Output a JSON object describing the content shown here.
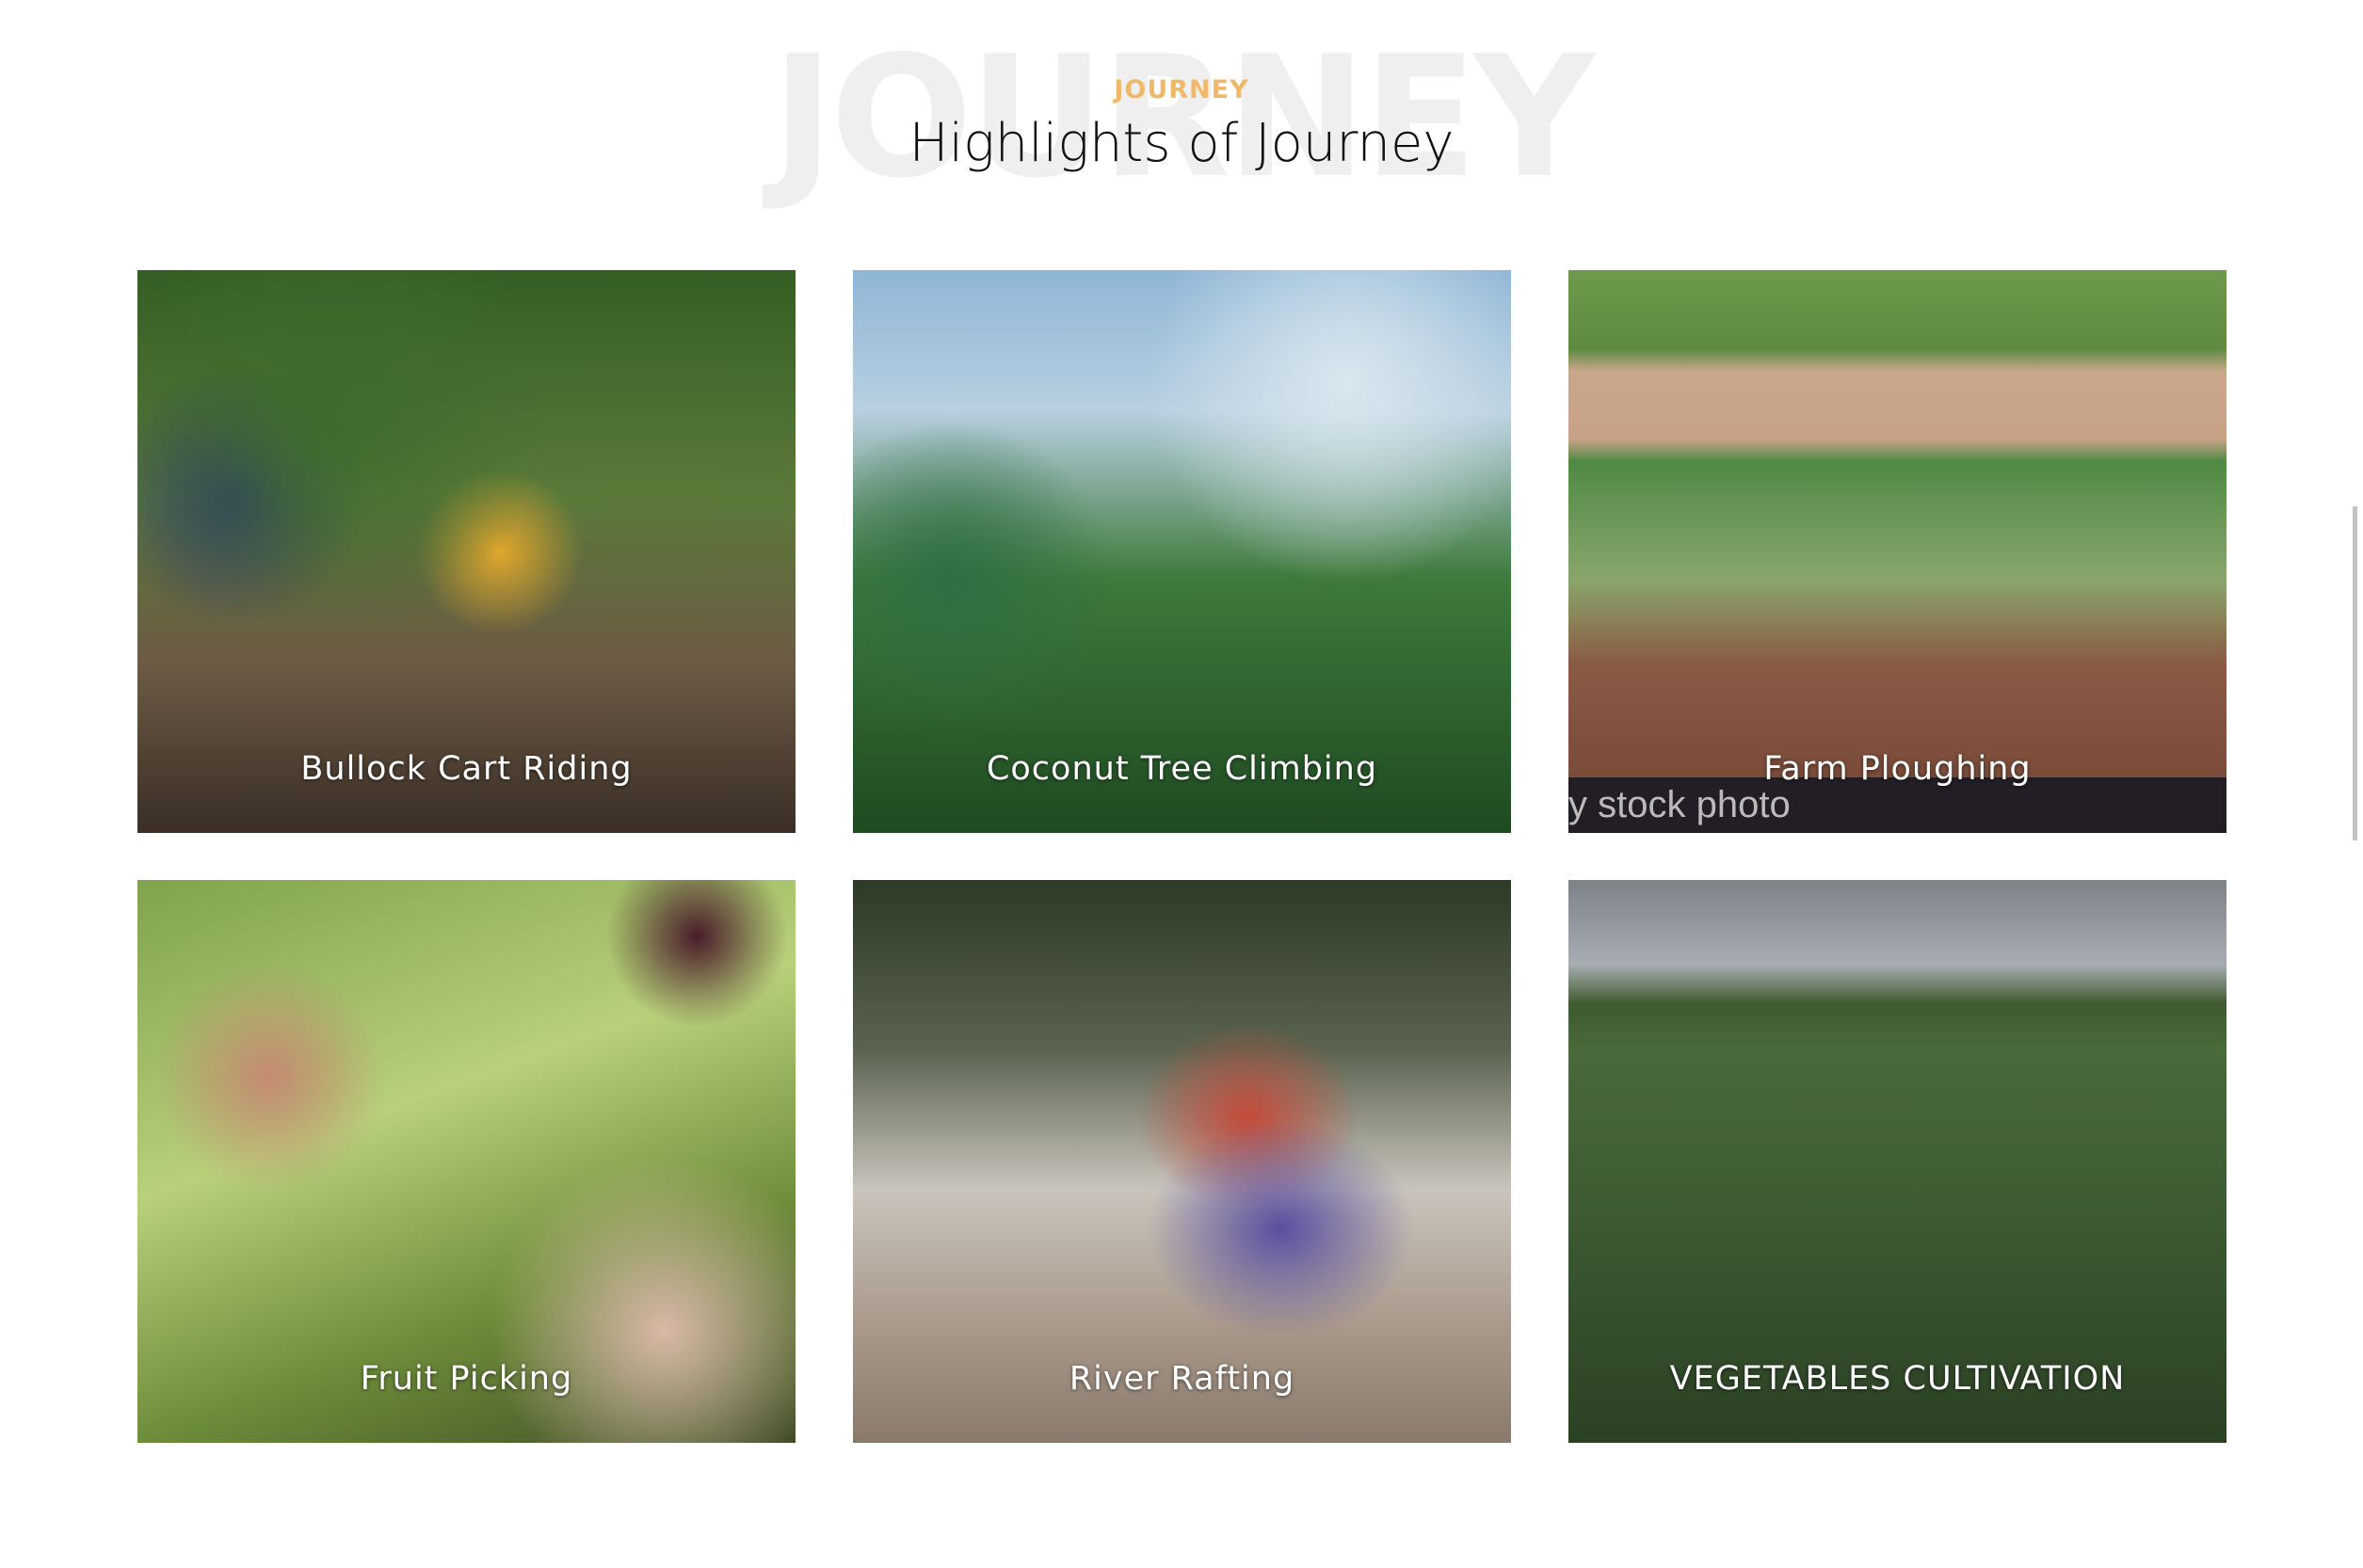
{
  "header": {
    "watermark": "JOURNEY",
    "kicker": "JOURNEY",
    "title": "Highlights of Journey"
  },
  "cards": [
    {
      "label": "Bullock Cart Riding"
    },
    {
      "label": "Coconut Tree Climbing"
    },
    {
      "label": "Farm Ploughing",
      "overlay_text": "y stock photo"
    },
    {
      "label": "Fruit Picking"
    },
    {
      "label": "River Rafting"
    },
    {
      "label": "VEGETABLES CULTIVATION"
    }
  ],
  "colors": {
    "accent": "#efb969",
    "watermark": "#efefef"
  }
}
